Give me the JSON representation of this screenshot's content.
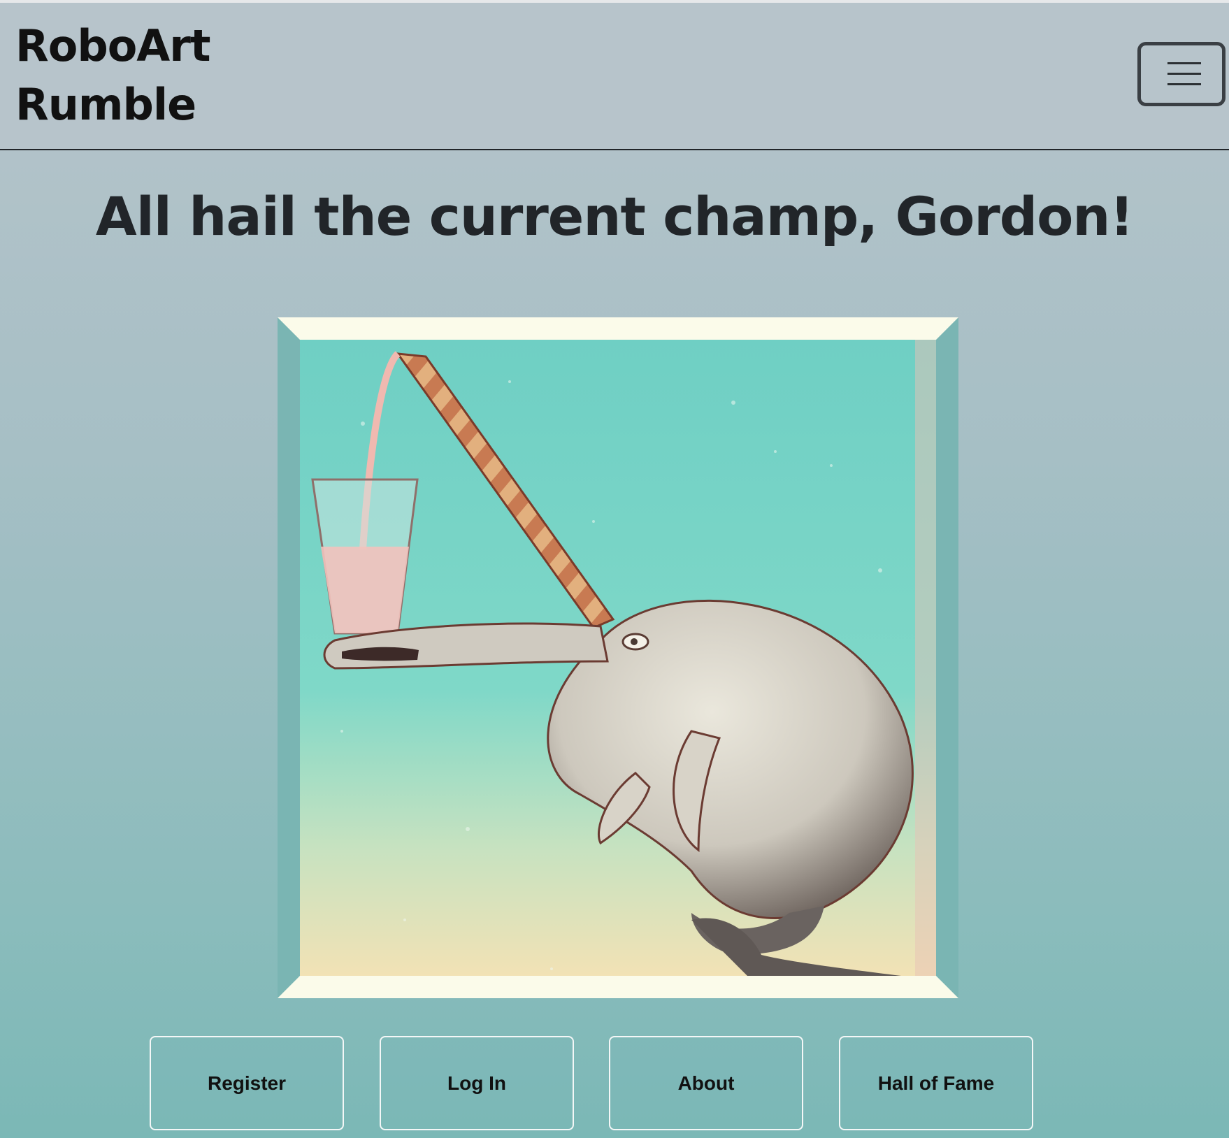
{
  "navbar": {
    "brand": "RoboArt Rumble",
    "toggler_icon": "hamburger-menu-icon"
  },
  "main": {
    "headline": "All hail the current champ, Gordon!",
    "artwork": {
      "description_icon": "narwhal-artwork"
    }
  },
  "buttons": {
    "register": "Register",
    "login": "Log In",
    "about": "About",
    "hall_of_fame": "Hall of Fame"
  },
  "colors": {
    "background_top": "#b7c4cb",
    "background_bottom": "#7bb8b6",
    "frame_light": "#fbfbea",
    "frame_side": "#7ab5b3",
    "text": "#212529"
  }
}
